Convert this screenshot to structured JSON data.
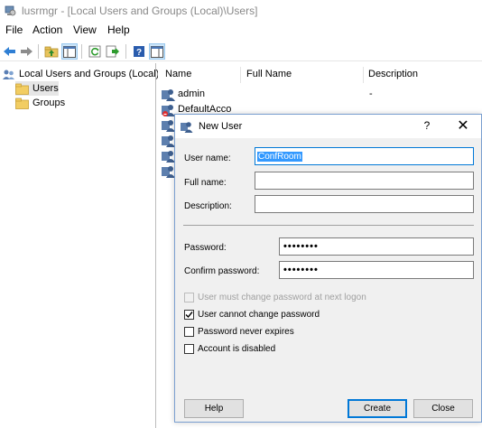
{
  "window": {
    "title": "lusrmgr - [Local Users and Groups (Local)\\Users]"
  },
  "menu": [
    "File",
    "Action",
    "View",
    "Help"
  ],
  "toolbar": {
    "icons": [
      "back-arrow-icon",
      "forward-arrow-icon",
      "up-folder-icon",
      "show-tree-icon",
      "refresh-icon",
      "export-list-icon",
      "help-book-icon",
      "properties-icon"
    ]
  },
  "tree": {
    "root": "Local Users and Groups (Local)",
    "children": [
      {
        "label": "Users",
        "selected": true
      },
      {
        "label": "Groups",
        "selected": false
      }
    ]
  },
  "list": {
    "columns": [
      "Name",
      "Full Name",
      "Description"
    ],
    "rows": [
      {
        "name": "admin",
        "description": "-"
      },
      {
        "name": "DefaultAcco"
      }
    ]
  },
  "dialog": {
    "title": "New User",
    "help_glyph": "?",
    "close_glyph": "✕",
    "username_label": "User name:",
    "username_value": "ConfRoom",
    "fullname_label": "Full name:",
    "fullname_value": "",
    "description_label": "Description:",
    "description_value": "",
    "password_label": "Password:",
    "password_value": "••••••••",
    "confirm_label": "Confirm password:",
    "confirm_value": "••••••••",
    "checkboxes": [
      {
        "label": "User must change password at next logon",
        "checked": false,
        "disabled": true
      },
      {
        "label": "User cannot change password",
        "checked": true,
        "disabled": false
      },
      {
        "label": "Password never expires",
        "checked": false,
        "disabled": false
      },
      {
        "label": "Account is disabled",
        "checked": false,
        "disabled": false
      }
    ],
    "help_button": "Help",
    "create_button": "Create",
    "close_button": "Close"
  }
}
